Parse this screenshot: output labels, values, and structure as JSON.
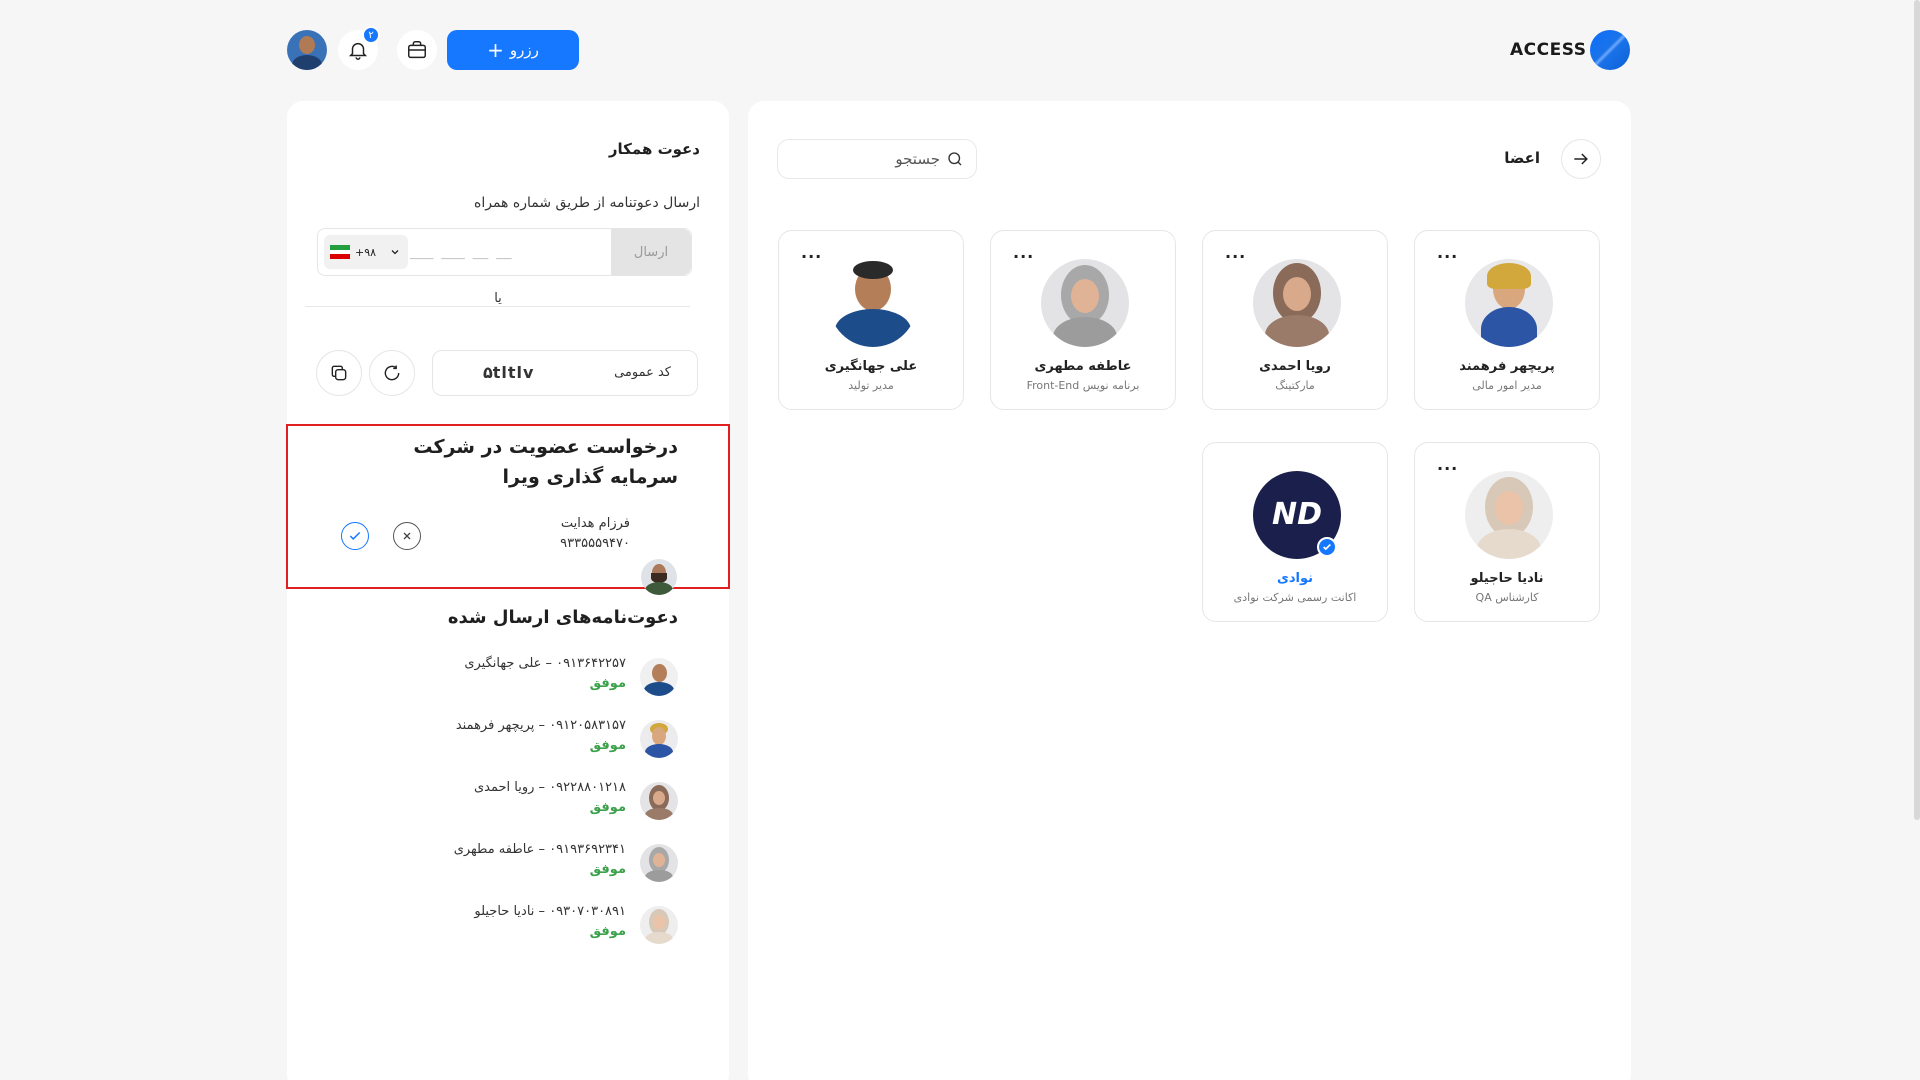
{
  "header": {
    "logo_text": "ACCESS",
    "reserve_label": "رزرو",
    "notif_count": "۲",
    "colors": {
      "accent": "#1677ff",
      "success": "#3ca14b",
      "highlight": "#e02020"
    },
    "icons": [
      "briefcase-icon",
      "bell-icon",
      "plus-icon"
    ]
  },
  "members": {
    "title": "اعضا",
    "search_placeholder": "جستجو",
    "cards": [
      {
        "name": "پریچهر فرهمند",
        "role": "مدیر امور مالی",
        "menu": "..."
      },
      {
        "name": "رویا احمدی",
        "role": "مارکتینگ",
        "menu": "..."
      },
      {
        "name": "عاطفه مطهری",
        "role": "برنامه نویس Front-End",
        "menu": "..."
      },
      {
        "name": "علی جهانگیری",
        "role": "مدیر تولید",
        "menu": "..."
      },
      {
        "name": "نادیا حاجیلو",
        "role": "کارشناس QA",
        "menu": "..."
      },
      {
        "name": "نوادی",
        "role": "اکانت رسمی شرکت نوادی",
        "logo_text": "ND"
      }
    ]
  },
  "invite": {
    "title": "دعوت همکار",
    "subtitle": "ارسال دعوتنامه از طریق شماره همراه",
    "send_label": "ارسال",
    "phone_placeholder": "___ ___ __ __",
    "country_code": "+۹۸",
    "or_text": "یا",
    "public_code_label": "کد عمومی",
    "public_code_value": "۵tltlv"
  },
  "request": {
    "title": "درخواست عضویت در شرکت سرمایه گذاری ویرا",
    "name": "فرزام هدایت",
    "phone": "۹۳۳۵۵۵۹۴۷۰"
  },
  "sent": {
    "title": "دعوت‌نامه‌های ارسال شده",
    "items": [
      {
        "text": "۰۹۱۳۶۴۲۲۵۷ – علی جهانگیری",
        "status": "موفق"
      },
      {
        "text": "۰۹۱۲۰۵۸۳۱۵۷ – پریچهر فرهمند",
        "status": "موفق"
      },
      {
        "text": "۰۹۲۲۸۸۰۱۲۱۸ – رویا احمدی",
        "status": "موفق"
      },
      {
        "text": "۰۹۱۹۳۶۹۲۳۴۱ – عاطفه مطهری",
        "status": "موفق"
      },
      {
        "text": "۰۹۳۰۷۰۳۰۸۹۱ – نادیا حاجیلو",
        "status": "موفق"
      }
    ]
  }
}
